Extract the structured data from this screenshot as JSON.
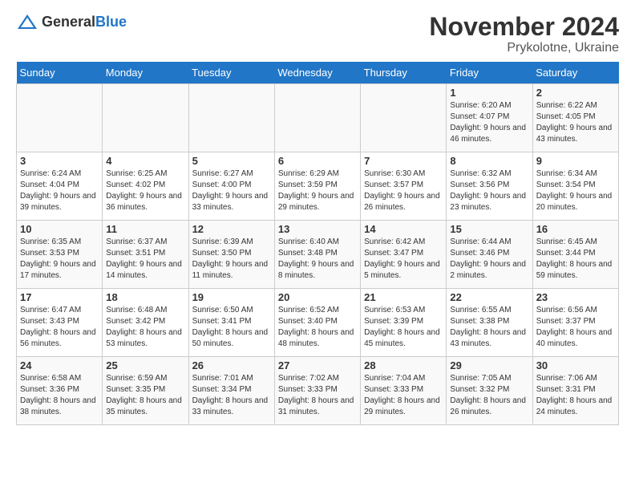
{
  "header": {
    "logo_general": "General",
    "logo_blue": "Blue",
    "title": "November 2024",
    "subtitle": "Prykolotne, Ukraine"
  },
  "days_of_week": [
    "Sunday",
    "Monday",
    "Tuesday",
    "Wednesday",
    "Thursday",
    "Friday",
    "Saturday"
  ],
  "weeks": [
    [
      {
        "day": "",
        "info": ""
      },
      {
        "day": "",
        "info": ""
      },
      {
        "day": "",
        "info": ""
      },
      {
        "day": "",
        "info": ""
      },
      {
        "day": "",
        "info": ""
      },
      {
        "day": "1",
        "info": "Sunrise: 6:20 AM\nSunset: 4:07 PM\nDaylight: 9 hours and 46 minutes."
      },
      {
        "day": "2",
        "info": "Sunrise: 6:22 AM\nSunset: 4:05 PM\nDaylight: 9 hours and 43 minutes."
      }
    ],
    [
      {
        "day": "3",
        "info": "Sunrise: 6:24 AM\nSunset: 4:04 PM\nDaylight: 9 hours and 39 minutes."
      },
      {
        "day": "4",
        "info": "Sunrise: 6:25 AM\nSunset: 4:02 PM\nDaylight: 9 hours and 36 minutes."
      },
      {
        "day": "5",
        "info": "Sunrise: 6:27 AM\nSunset: 4:00 PM\nDaylight: 9 hours and 33 minutes."
      },
      {
        "day": "6",
        "info": "Sunrise: 6:29 AM\nSunset: 3:59 PM\nDaylight: 9 hours and 29 minutes."
      },
      {
        "day": "7",
        "info": "Sunrise: 6:30 AM\nSunset: 3:57 PM\nDaylight: 9 hours and 26 minutes."
      },
      {
        "day": "8",
        "info": "Sunrise: 6:32 AM\nSunset: 3:56 PM\nDaylight: 9 hours and 23 minutes."
      },
      {
        "day": "9",
        "info": "Sunrise: 6:34 AM\nSunset: 3:54 PM\nDaylight: 9 hours and 20 minutes."
      }
    ],
    [
      {
        "day": "10",
        "info": "Sunrise: 6:35 AM\nSunset: 3:53 PM\nDaylight: 9 hours and 17 minutes."
      },
      {
        "day": "11",
        "info": "Sunrise: 6:37 AM\nSunset: 3:51 PM\nDaylight: 9 hours and 14 minutes."
      },
      {
        "day": "12",
        "info": "Sunrise: 6:39 AM\nSunset: 3:50 PM\nDaylight: 9 hours and 11 minutes."
      },
      {
        "day": "13",
        "info": "Sunrise: 6:40 AM\nSunset: 3:48 PM\nDaylight: 9 hours and 8 minutes."
      },
      {
        "day": "14",
        "info": "Sunrise: 6:42 AM\nSunset: 3:47 PM\nDaylight: 9 hours and 5 minutes."
      },
      {
        "day": "15",
        "info": "Sunrise: 6:44 AM\nSunset: 3:46 PM\nDaylight: 9 hours and 2 minutes."
      },
      {
        "day": "16",
        "info": "Sunrise: 6:45 AM\nSunset: 3:44 PM\nDaylight: 8 hours and 59 minutes."
      }
    ],
    [
      {
        "day": "17",
        "info": "Sunrise: 6:47 AM\nSunset: 3:43 PM\nDaylight: 8 hours and 56 minutes."
      },
      {
        "day": "18",
        "info": "Sunrise: 6:48 AM\nSunset: 3:42 PM\nDaylight: 8 hours and 53 minutes."
      },
      {
        "day": "19",
        "info": "Sunrise: 6:50 AM\nSunset: 3:41 PM\nDaylight: 8 hours and 50 minutes."
      },
      {
        "day": "20",
        "info": "Sunrise: 6:52 AM\nSunset: 3:40 PM\nDaylight: 8 hours and 48 minutes."
      },
      {
        "day": "21",
        "info": "Sunrise: 6:53 AM\nSunset: 3:39 PM\nDaylight: 8 hours and 45 minutes."
      },
      {
        "day": "22",
        "info": "Sunrise: 6:55 AM\nSunset: 3:38 PM\nDaylight: 8 hours and 43 minutes."
      },
      {
        "day": "23",
        "info": "Sunrise: 6:56 AM\nSunset: 3:37 PM\nDaylight: 8 hours and 40 minutes."
      }
    ],
    [
      {
        "day": "24",
        "info": "Sunrise: 6:58 AM\nSunset: 3:36 PM\nDaylight: 8 hours and 38 minutes."
      },
      {
        "day": "25",
        "info": "Sunrise: 6:59 AM\nSunset: 3:35 PM\nDaylight: 8 hours and 35 minutes."
      },
      {
        "day": "26",
        "info": "Sunrise: 7:01 AM\nSunset: 3:34 PM\nDaylight: 8 hours and 33 minutes."
      },
      {
        "day": "27",
        "info": "Sunrise: 7:02 AM\nSunset: 3:33 PM\nDaylight: 8 hours and 31 minutes."
      },
      {
        "day": "28",
        "info": "Sunrise: 7:04 AM\nSunset: 3:33 PM\nDaylight: 8 hours and 29 minutes."
      },
      {
        "day": "29",
        "info": "Sunrise: 7:05 AM\nSunset: 3:32 PM\nDaylight: 8 hours and 26 minutes."
      },
      {
        "day": "30",
        "info": "Sunrise: 7:06 AM\nSunset: 3:31 PM\nDaylight: 8 hours and 24 minutes."
      }
    ]
  ]
}
